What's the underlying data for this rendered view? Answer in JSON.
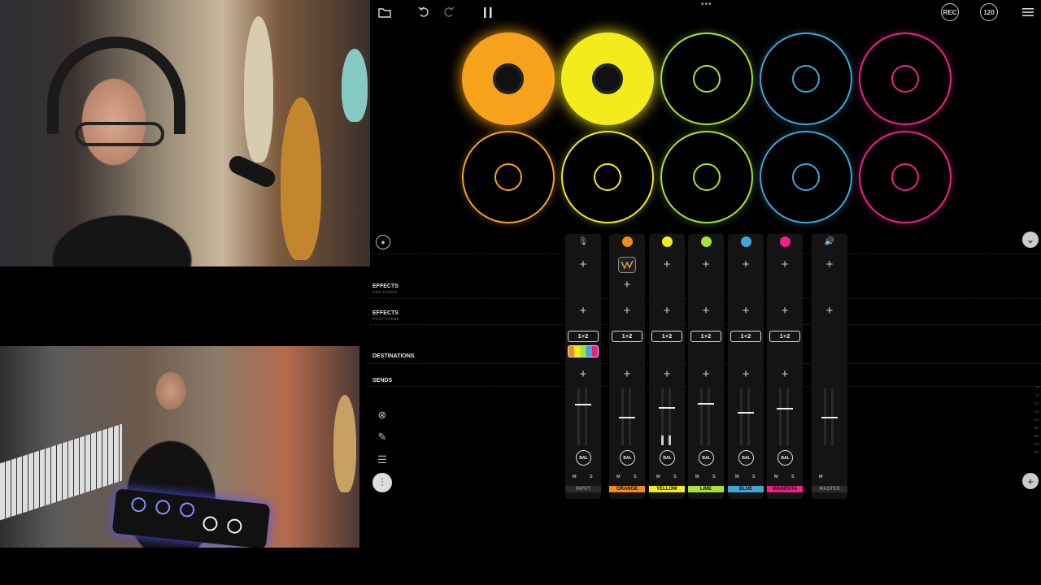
{
  "toolbar": {
    "folder_icon": "folder-icon",
    "undo_icon": "undo-icon",
    "redo_icon": "redo-icon",
    "pause_icon": "pause-icon",
    "rec_label": "REC",
    "bpm_label": "120",
    "menu_icon": "hamburger-menu-icon"
  },
  "pads": {
    "colors": [
      "#f7a21b",
      "#f2ec1c",
      "#a6e33a",
      "#3fa6d8",
      "#f0208a"
    ],
    "top_active": [
      true,
      true,
      false,
      false,
      false
    ]
  },
  "mixer": {
    "labels": {
      "effects_pre": "EFFECTS",
      "effects_pre_sub": "PRE-FADER",
      "effects_post": "EFFECTS",
      "effects_post_sub": "POST-FADER",
      "destinations": "DESTINATIONS",
      "sends": "SENDS"
    },
    "dest_label": "1+2",
    "bal_label": "BAL",
    "m_label": "M",
    "s_label": "S",
    "add_symbol": "+",
    "channels": [
      {
        "name": "INPUT",
        "color": "#555555",
        "tag_color": "#2a2a2a"
      },
      {
        "name": "ORANGE",
        "color": "#f28a1e",
        "tag_color": "#f28a1e"
      },
      {
        "name": "YELLOW",
        "color": "#f2ec1c",
        "tag_color": "#f2ec1c"
      },
      {
        "name": "LIME",
        "color": "#a6e33a",
        "tag_color": "#a6e33a"
      },
      {
        "name": "BLUE",
        "color": "#3fa6d8",
        "tag_color": "#3fa6d8"
      },
      {
        "name": "MAGENTA",
        "color": "#f0208a",
        "tag_color": "#f0208a"
      },
      {
        "name": "MASTER",
        "color": "#555555",
        "tag_color": "#2a2a2a"
      }
    ],
    "scale": [
      "0",
      "-6",
      "-12",
      "-18",
      "-24",
      "-30",
      "-36",
      "-42",
      "-48"
    ]
  }
}
